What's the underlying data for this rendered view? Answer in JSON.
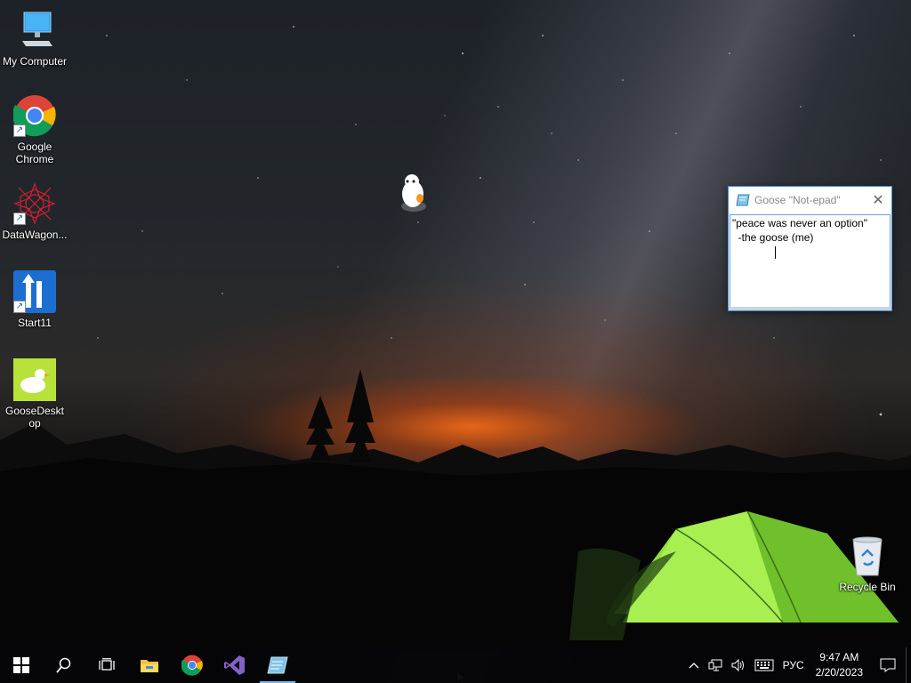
{
  "desktop": {
    "icons": [
      {
        "label": "My Computer",
        "icon": "computer-icon"
      },
      {
        "label": "Google Chrome",
        "icon": "chrome-icon"
      },
      {
        "label": "DataWagon...",
        "icon": "datawagon-icon"
      },
      {
        "label": "Start11",
        "icon": "start11-icon"
      },
      {
        "label": "GooseDesktop",
        "icon": "goose-desktop-icon"
      },
      {
        "label": "Recycle Bin",
        "icon": "recycle-bin-icon"
      }
    ]
  },
  "notepad": {
    "title": "Goose \"Not-epad\"",
    "lines": [
      "\"peace was never an option\"",
      "  -the goose (me)"
    ]
  },
  "taskbar": {
    "apps": [
      "start-icon",
      "search-icon",
      "task-view-icon",
      "file-explorer-icon",
      "chrome-icon",
      "visual-studio-icon",
      "notepad-icon"
    ],
    "tray": {
      "language": "РУС",
      "time": "9:47 AM",
      "date": "2/20/2023"
    }
  },
  "colors": {
    "taskbar_accent": "#76b9ed",
    "tent_green": "#8fe03a",
    "sunset_orange": "#ff6e14"
  }
}
